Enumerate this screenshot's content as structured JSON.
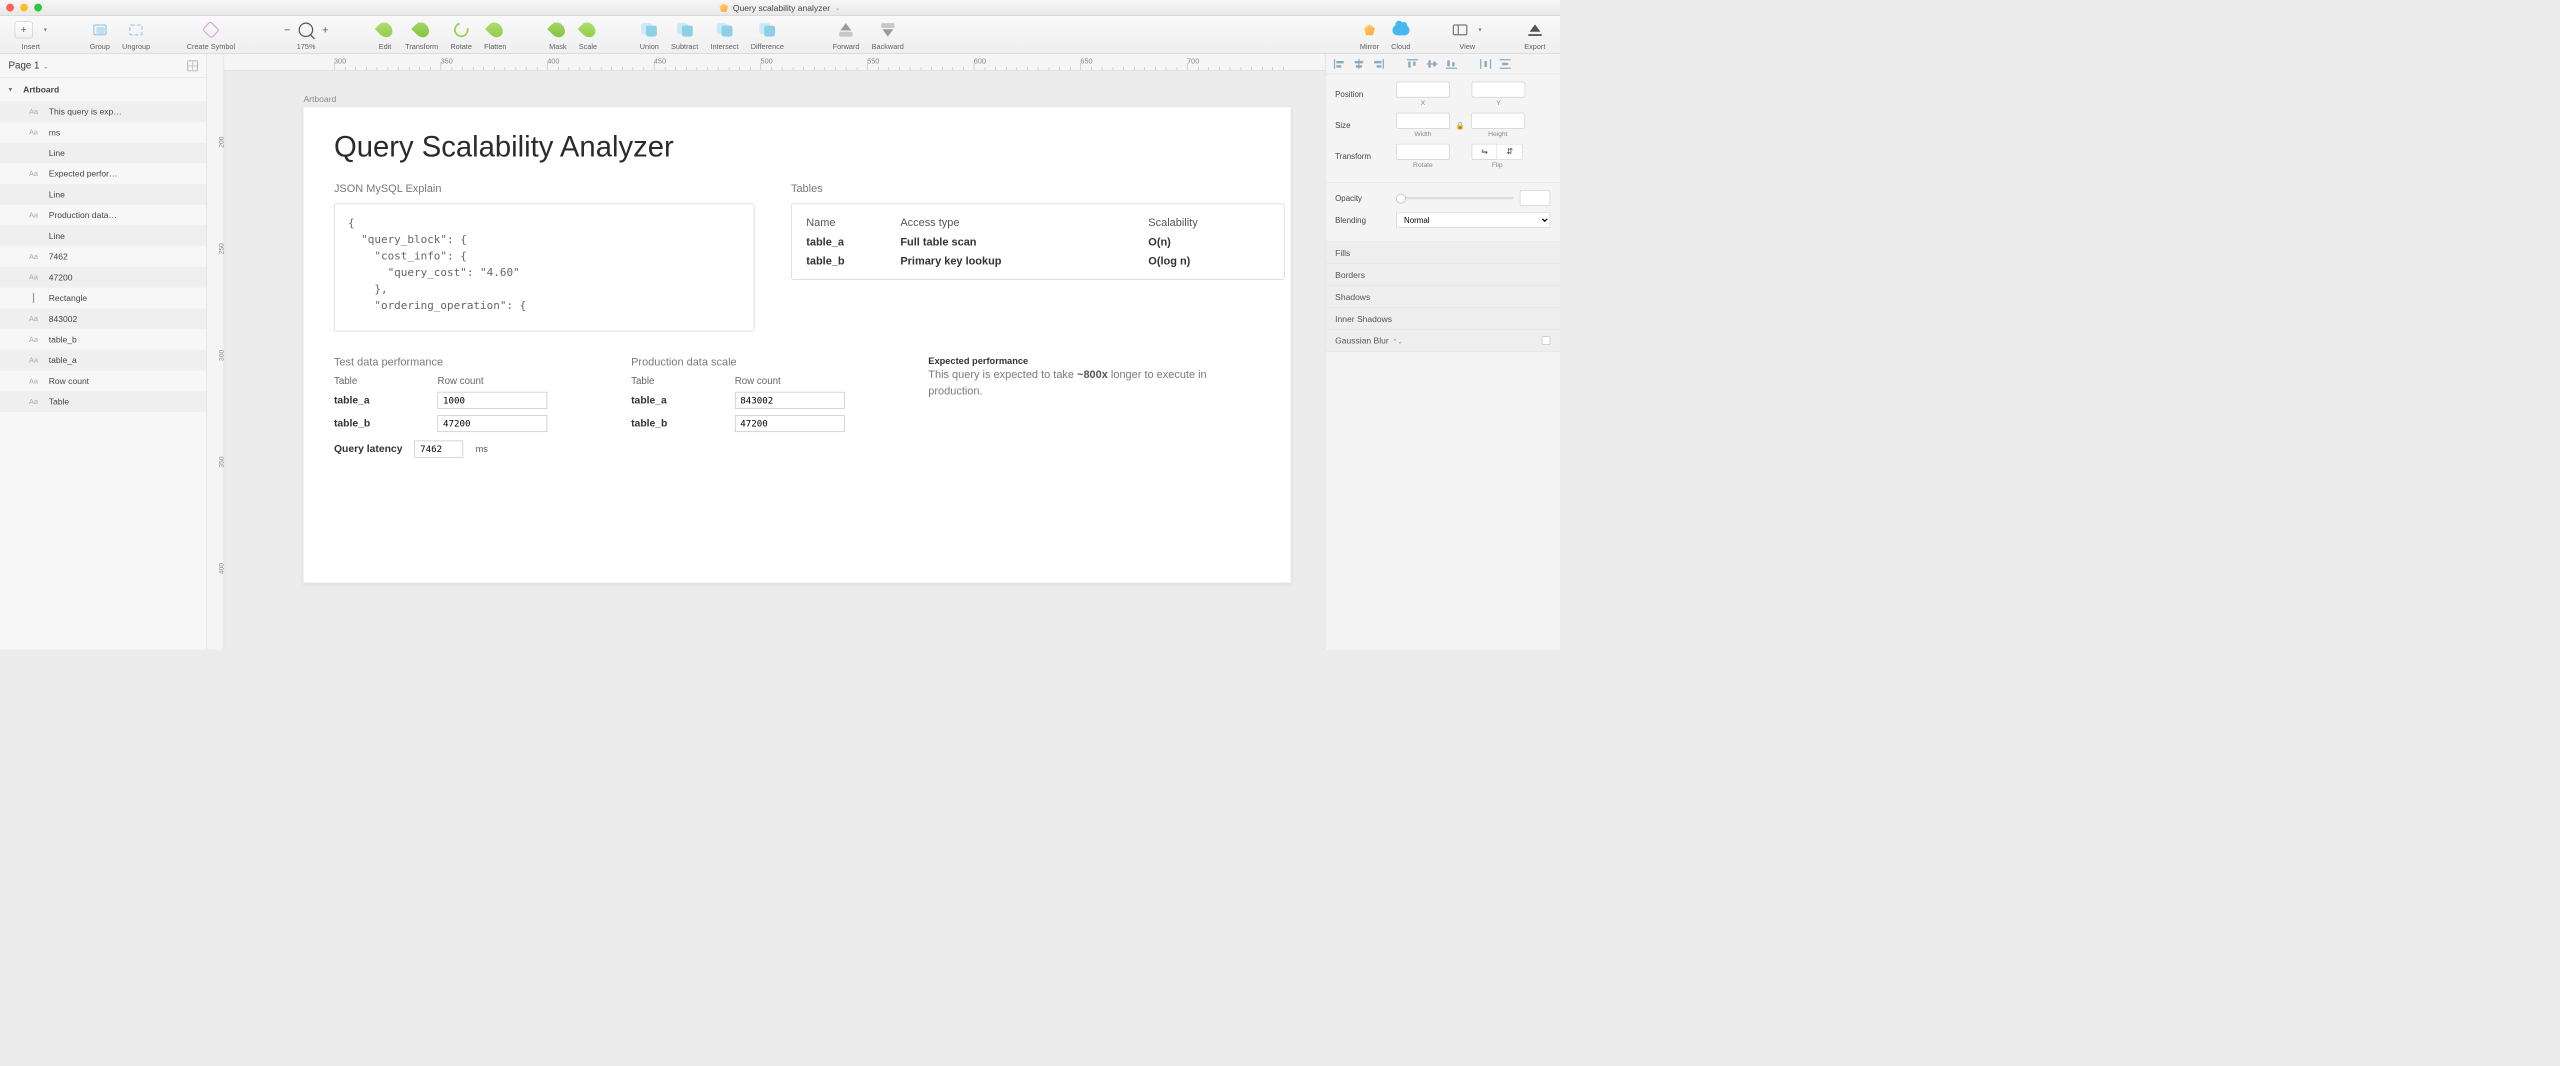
{
  "title": "Query scalability analyzer",
  "toolbar": {
    "insert": "Insert",
    "group": "Group",
    "ungroup": "Ungroup",
    "create_symbol": "Create Symbol",
    "zoom": "175%",
    "edit": "Edit",
    "transform": "Transform",
    "rotate": "Rotate",
    "flatten": "Flatten",
    "mask": "Mask",
    "scale": "Scale",
    "union": "Union",
    "subtract": "Subtract",
    "intersect": "Intersect",
    "difference": "Difference",
    "forward": "Forward",
    "backward": "Backward",
    "mirror": "Mirror",
    "cloud": "Cloud",
    "view": "View",
    "export": "Export"
  },
  "pages": {
    "selected": "Page 1"
  },
  "layers": [
    {
      "kind": "artboard",
      "label": "Artboard"
    },
    {
      "kind": "text",
      "label": "This query is exp…"
    },
    {
      "kind": "text",
      "label": "ms"
    },
    {
      "kind": "line",
      "label": "Line"
    },
    {
      "kind": "text",
      "label": "Expected perfor…"
    },
    {
      "kind": "line",
      "label": "Line"
    },
    {
      "kind": "text",
      "label": "Production data…"
    },
    {
      "kind": "line",
      "label": "Line"
    },
    {
      "kind": "text",
      "label": "7462"
    },
    {
      "kind": "text",
      "label": "47200"
    },
    {
      "kind": "rect",
      "label": "Rectangle"
    },
    {
      "kind": "text",
      "label": "843002"
    },
    {
      "kind": "text",
      "label": "table_b"
    },
    {
      "kind": "text",
      "label": "table_a"
    },
    {
      "kind": "text",
      "label": "Row count"
    },
    {
      "kind": "text",
      "label": "Table"
    }
  ],
  "ruler_h": [
    "300",
    "350",
    "400",
    "450",
    "500",
    "550",
    "600",
    "650",
    "700"
  ],
  "ruler_v": [
    "200",
    "250",
    "300",
    "350",
    "400"
  ],
  "artboard": {
    "label": "Artboard",
    "title": "Query Scalability Analyzer",
    "json_label": "JSON MySQL Explain",
    "json_code": "{\n  \"query_block\": {\n    \"cost_info\": {\n      \"query_cost\": \"4.60\"\n    },\n    \"ordering_operation\": {",
    "tables_label": "Tables",
    "tables_headers": {
      "name": "Name",
      "access": "Access type",
      "scal": "Scalability"
    },
    "tables": [
      {
        "name": "table_a",
        "access": "Full table scan",
        "scal": "O(n)"
      },
      {
        "name": "table_b",
        "access": "Primary key lookup",
        "scal": "O(log n)"
      }
    ],
    "test_perf_label": "Test data performance",
    "prod_perf_label": "Production data scale",
    "expected_label": "Expected performance",
    "col_table": "Table",
    "col_rowcount": "Row count",
    "test_rows": [
      {
        "name": "table_a",
        "count": "1000"
      },
      {
        "name": "table_b",
        "count": "47200"
      }
    ],
    "prod_rows": [
      {
        "name": "table_a",
        "count": "843002"
      },
      {
        "name": "table_b",
        "count": "47200"
      }
    ],
    "query_latency_label": "Query latency",
    "query_latency_value": "7462",
    "query_latency_unit": "ms",
    "expected_text_pre": "This query is expected to take ",
    "expected_text_bold": "~800x",
    "expected_text_post": " longer to execute in production."
  },
  "inspector": {
    "position": "Position",
    "x": "X",
    "y": "Y",
    "size": "Size",
    "width": "Width",
    "height": "Height",
    "transform": "Transform",
    "rotate": "Rotate",
    "flip": "Flip",
    "opacity": "Opacity",
    "blending": "Blending",
    "blending_value": "Normal",
    "fills": "Fills",
    "borders": "Borders",
    "shadows": "Shadows",
    "inner_shadows": "Inner Shadows",
    "gaussian_blur": "Gaussian Blur"
  }
}
